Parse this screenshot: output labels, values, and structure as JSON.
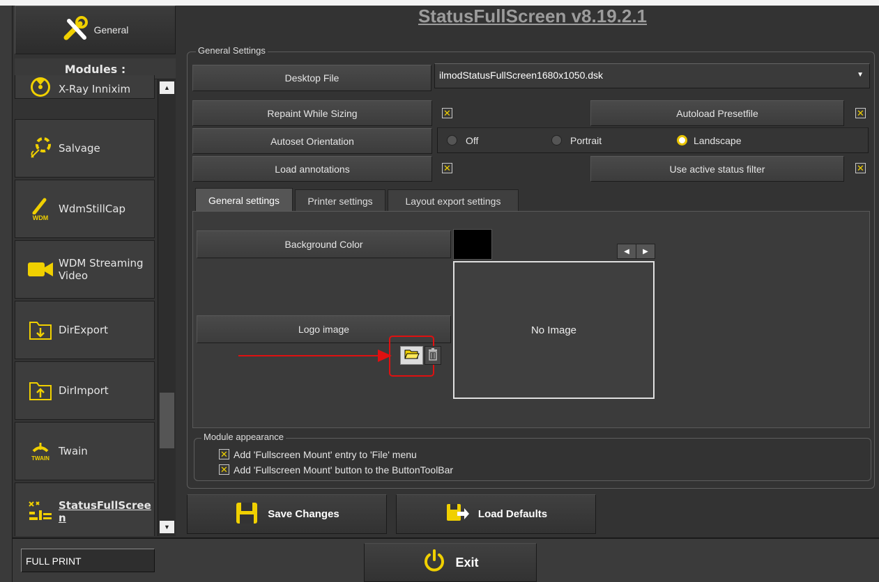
{
  "app": {
    "title": "StatusFullScreen v8.19.2.1"
  },
  "sidebar": {
    "general_label": "General",
    "modules_header": "Modules :",
    "items": [
      {
        "label": "X-Ray Innixim",
        "icon": "radiation-icon"
      },
      {
        "label": "Salvage",
        "icon": "lifebuoy-icon"
      },
      {
        "label": "WdmStillCap",
        "icon": "wdm-still-icon",
        "icon_caption": "WDM"
      },
      {
        "label": "WDM Streaming Video",
        "icon": "video-camera-icon"
      },
      {
        "label": "DirExport",
        "icon": "folder-export-icon"
      },
      {
        "label": "DirImport",
        "icon": "folder-import-icon"
      },
      {
        "label": "Twain",
        "icon": "twain-icon",
        "icon_caption": "TWAIN"
      },
      {
        "label": "StatusFullScreen",
        "icon": "status-fullscreen-icon"
      }
    ]
  },
  "general_settings": {
    "legend": "General Settings",
    "desktop_file_label": "Desktop File",
    "desktop_file_value": "ilmodStatusFullScreen1680x1050.dsk",
    "repaint_label": "Repaint While Sizing",
    "repaint_checked": true,
    "autoload_label": "Autoload Presetfile",
    "autoload_checked": true,
    "orientation_label": "Autoset Orientation",
    "orientation_options": [
      "Off",
      "Portrait",
      "Landscape"
    ],
    "orientation_selected": "Landscape",
    "annotations_label": "Load annotations",
    "annotations_checked": true,
    "status_filter_label": "Use active status filter",
    "status_filter_checked": true
  },
  "tabs": [
    "General settings",
    "Printer settings",
    "Layout export settings"
  ],
  "active_tab": "General settings",
  "tab_panel": {
    "background_color_label": "Background Color",
    "background_color_value": "#000000",
    "logo_image_label": "Logo image",
    "no_image_text": "No Image"
  },
  "module_appearance": {
    "legend": "Module appearance",
    "options": [
      {
        "label": "Add 'Fullscreen Mount' entry to 'File' menu",
        "checked": true
      },
      {
        "label": "Add 'Fullscreen Mount' button to the ButtonToolBar",
        "checked": true
      }
    ]
  },
  "buttons": {
    "save": "Save Changes",
    "defaults": "Load Defaults",
    "exit": "Exit"
  },
  "status": {
    "printer_field": "FULL PRINT"
  },
  "colors": {
    "accent_yellow": "#f0d000",
    "annotation_red": "#e01010",
    "panel_bg": "#333333"
  }
}
